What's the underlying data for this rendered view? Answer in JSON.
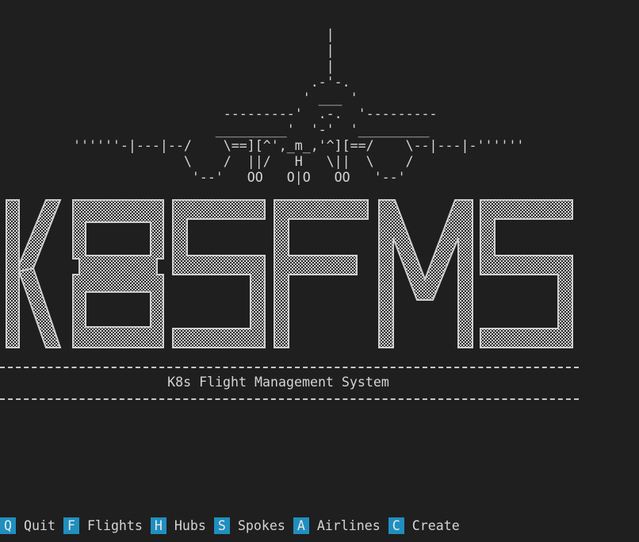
{
  "app": {
    "subtitle": "K8s Flight Management System",
    "logo_text": "K8SFMS",
    "colors": {
      "background": "#1f1f1f",
      "foreground": "#d4d4d4",
      "key_badge": "#1f8fbf"
    }
  },
  "ascii_plane": [
    "                                  |",
    "                                  |",
    "                                  |",
    "                                .-'-.",
    "                               ' ___ '",
    "                     ---------'  .-.  '---------",
    "                    _________'  '-'  '_________",
    "  ''''''-|---|--/    \\==][^',_m_,'^][==/    \\--|---|-''''''",
    "                \\    /  ||/   H   \\||  \\    /",
    "                 '--'   OO   O|O   OO   '--'"
  ],
  "footer": {
    "commands": [
      {
        "key": "Q",
        "label": "Quit"
      },
      {
        "key": "F",
        "label": "Flights"
      },
      {
        "key": "H",
        "label": "Hubs"
      },
      {
        "key": "S",
        "label": "Spokes"
      },
      {
        "key": "A",
        "label": "Airlines"
      },
      {
        "key": "C",
        "label": "Create"
      }
    ]
  }
}
